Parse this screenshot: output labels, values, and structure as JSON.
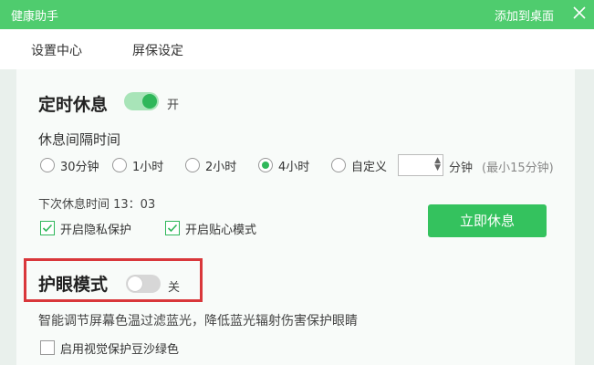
{
  "titlebar": {
    "title": "健康助手",
    "add_to_desktop": "添加到桌面",
    "close_icon": "close-icon"
  },
  "tabs": [
    {
      "label": "设置中心",
      "active": true
    },
    {
      "label": "屏保设定",
      "active": false
    }
  ],
  "timed_rest": {
    "title": "定时休息",
    "toggle_on": true,
    "toggle_label": "开",
    "interval_label": "休息间隔时间",
    "options": [
      "30分钟",
      "1小时",
      "2小时",
      "4小时",
      "自定义"
    ],
    "selected_index": 3,
    "custom_value": "",
    "custom_unit": "分钟",
    "custom_hint": "(最小15分钟)",
    "next_rest": "下次休息时间 13：03",
    "privacy_label": "开启隐私保护",
    "privacy_checked": true,
    "caring_label": "开启贴心模式",
    "caring_checked": true,
    "rest_now": "立即休息"
  },
  "eye_mode": {
    "title": "护眼模式",
    "toggle_on": false,
    "toggle_label": "关",
    "description": "智能调节屏幕色温过滤蓝光，降低蓝光辐射伤害保护眼睛",
    "green_label": "启用视觉保护豆沙绿色",
    "green_checked": false
  },
  "colors": {
    "accent": "#4fcc6e",
    "button": "#34c25e",
    "highlight": "#d9373b"
  }
}
